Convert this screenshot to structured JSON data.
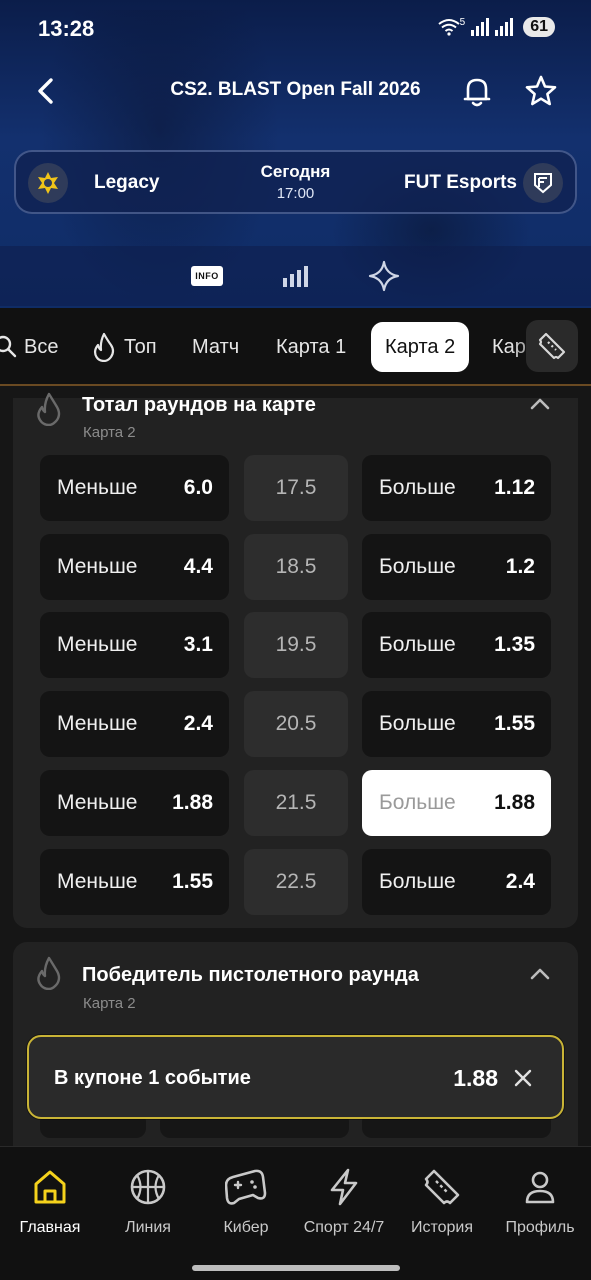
{
  "status_bar": {
    "time": "13:28",
    "battery": "61",
    "network": "5"
  },
  "header": {
    "title": "CS2. BLAST Open Fall 2026",
    "back_icon": "back-arrow-icon",
    "bell_icon": "bell-icon",
    "star_icon": "star-icon"
  },
  "match": {
    "team1": "Legacy",
    "team2": "FUT Esports",
    "date": "Сегодня",
    "time": "17:00"
  },
  "hero_tabs": {
    "info_label": "INFO",
    "stats_icon": "bar-chart-icon",
    "sparkle_icon": "sparkle-icon"
  },
  "market_tabs": [
    {
      "label": "Все",
      "icon": "search-icon"
    },
    {
      "label": "Топ",
      "icon": "flame-icon"
    },
    {
      "label": "Матч"
    },
    {
      "label": "Карта 1"
    },
    {
      "label": "Карта 2",
      "active": true
    },
    {
      "label": "Кар"
    }
  ],
  "markets": [
    {
      "title": "Тотал раундов на карте",
      "subtitle": "Карта 2",
      "rows": [
        {
          "under_label": "Меньше",
          "under_odd": "6.0",
          "line": "17.5",
          "over_label": "Больше",
          "over_odd": "1.12"
        },
        {
          "under_label": "Меньше",
          "under_odd": "4.4",
          "line": "18.5",
          "over_label": "Больше",
          "over_odd": "1.2"
        },
        {
          "under_label": "Меньше",
          "under_odd": "3.1",
          "line": "19.5",
          "over_label": "Больше",
          "over_odd": "1.35"
        },
        {
          "under_label": "Меньше",
          "under_odd": "2.4",
          "line": "20.5",
          "over_label": "Больше",
          "over_odd": "1.55"
        },
        {
          "under_label": "Меньше",
          "under_odd": "1.88",
          "line": "21.5",
          "over_label": "Больше",
          "over_odd": "1.88",
          "over_selected": true
        },
        {
          "under_label": "Меньше",
          "under_odd": "1.55",
          "line": "22.5",
          "over_label": "Больше",
          "over_odd": "2.4"
        }
      ]
    },
    {
      "title": "Победитель пистолетного раунда",
      "subtitle": "Карта 2"
    }
  ],
  "coupon": {
    "label": "В купоне 1 событие",
    "value": "1.88"
  },
  "bottom_nav": [
    {
      "label": "Главная",
      "icon": "home-icon",
      "active": true
    },
    {
      "label": "Линия",
      "icon": "basketball-icon"
    },
    {
      "label": "Кибер",
      "icon": "gamepad-icon"
    },
    {
      "label": "Спорт 24/7",
      "icon": "lightning-icon"
    },
    {
      "label": "История",
      "icon": "ticket-icon"
    },
    {
      "label": "Профиль",
      "icon": "profile-icon"
    }
  ],
  "colors": {
    "accent": "#f5d21c",
    "selected_cell": "#ffffff",
    "coupon_border": "#c9b436",
    "hero_blue": "#13306e"
  }
}
